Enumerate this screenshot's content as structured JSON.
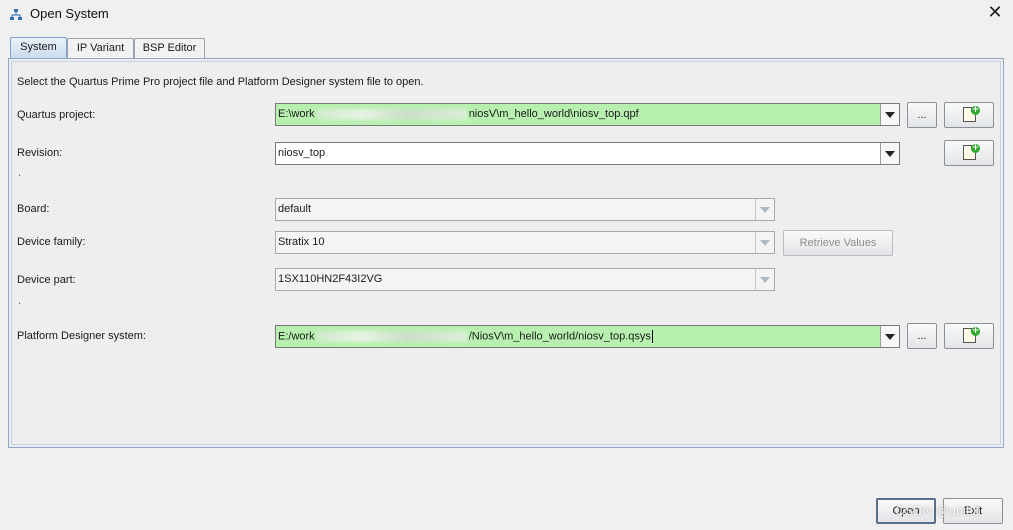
{
  "window": {
    "title": "Open System",
    "close_glyph": "✕",
    "app_icon": "network-icon"
  },
  "tabs": [
    {
      "label": "System",
      "active": true
    },
    {
      "label": "IP Variant",
      "active": false
    },
    {
      "label": "BSP Editor",
      "active": false
    }
  ],
  "intro_text": "Select the Quartus Prime Pro project file and Platform Designer system file to open.",
  "fields": {
    "quartus_project": {
      "label": "Quartus project:",
      "value_prefix": "E:\\work",
      "value_suffix": "niosV\\m_hello_world\\niosv_top.qpf",
      "browse_label": "..."
    },
    "revision": {
      "label": "Revision:",
      "value": "niosv_top"
    },
    "board": {
      "label": "Board:",
      "value": "default"
    },
    "device_family": {
      "label": "Device family:",
      "value": "Stratix 10",
      "retrieve_label": "Retrieve Values"
    },
    "device_part": {
      "label": "Device part:",
      "value": "1SX110HN2F43I2VG"
    },
    "platform_designer": {
      "label": "Platform Designer system:",
      "value_prefix": "E:/work",
      "value_suffix": "/NiosV\\m_hello_world/niosv_top.qsys",
      "browse_label": "..."
    }
  },
  "separator_dot": ".",
  "footer": {
    "open_label": "Open",
    "exit_label": "Exit"
  },
  "watermark": "CSDN @unit.ll",
  "colors": {
    "accent_field": "#b8f0b0",
    "tab_active": "#c9dbef"
  }
}
